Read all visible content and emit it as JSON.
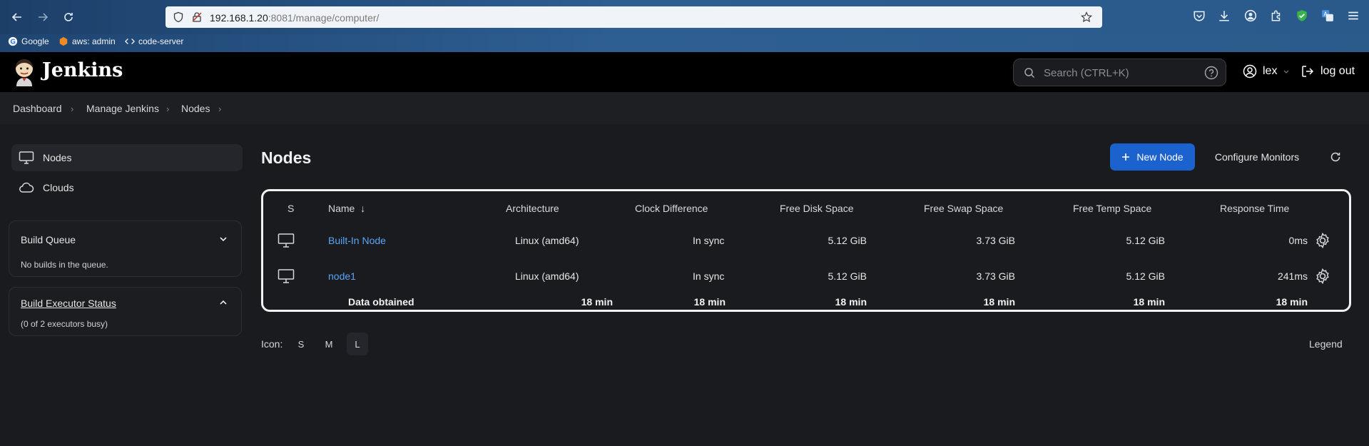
{
  "browser": {
    "url_host": "192.168.1.20",
    "url_rest": ":8081/manage/computer/",
    "bookmarks": [
      {
        "label": "Google"
      },
      {
        "label": "aws: admin"
      },
      {
        "label": "code-server"
      }
    ]
  },
  "header": {
    "brand": "Jenkins",
    "search_placeholder": "Search (CTRL+K)",
    "user": "lex",
    "logout": "log out"
  },
  "breadcrumb": [
    "Dashboard",
    "Manage Jenkins",
    "Nodes"
  ],
  "sidebar": {
    "items": [
      {
        "label": "Nodes",
        "icon": "monitor-icon"
      },
      {
        "label": "Clouds",
        "icon": "cloud-icon"
      }
    ],
    "build_queue": {
      "title": "Build Queue",
      "text": "No builds in the queue."
    },
    "executor_status": {
      "title": "Build Executor Status",
      "text": "(0 of 2 executors busy)"
    }
  },
  "main": {
    "title": "Nodes",
    "new_node": "New Node",
    "configure_monitors": "Configure Monitors",
    "columns": {
      "s": "S",
      "name": "Name",
      "sort_arrow": "↓",
      "architecture": "Architecture",
      "clock": "Clock Difference",
      "disk": "Free Disk Space",
      "swap": "Free Swap Space",
      "temp": "Free Temp Space",
      "response": "Response Time"
    },
    "rows": [
      {
        "name": "Built-In Node",
        "architecture": "Linux (amd64)",
        "clock": "In sync",
        "disk": "5.12 GiB",
        "swap": "3.73 GiB",
        "temp": "5.12 GiB",
        "response": "0ms"
      },
      {
        "name": "node1",
        "architecture": "Linux (amd64)",
        "clock": "In sync",
        "disk": "5.12 GiB",
        "swap": "3.73 GiB",
        "temp": "5.12 GiB",
        "response": "241ms"
      }
    ],
    "footer": {
      "label": "Data obtained",
      "architecture": "18 min",
      "clock": "18 min",
      "disk": "18 min",
      "swap": "18 min",
      "temp": "18 min",
      "response": "18 min"
    },
    "icon_label": "Icon:",
    "sizes": [
      "S",
      "M",
      "L"
    ],
    "selected_size": "L",
    "legend": "Legend"
  },
  "colors": {
    "primary_button": "#1c62cf",
    "link": "#5aa5f5",
    "background": "#1a1b1e"
  }
}
